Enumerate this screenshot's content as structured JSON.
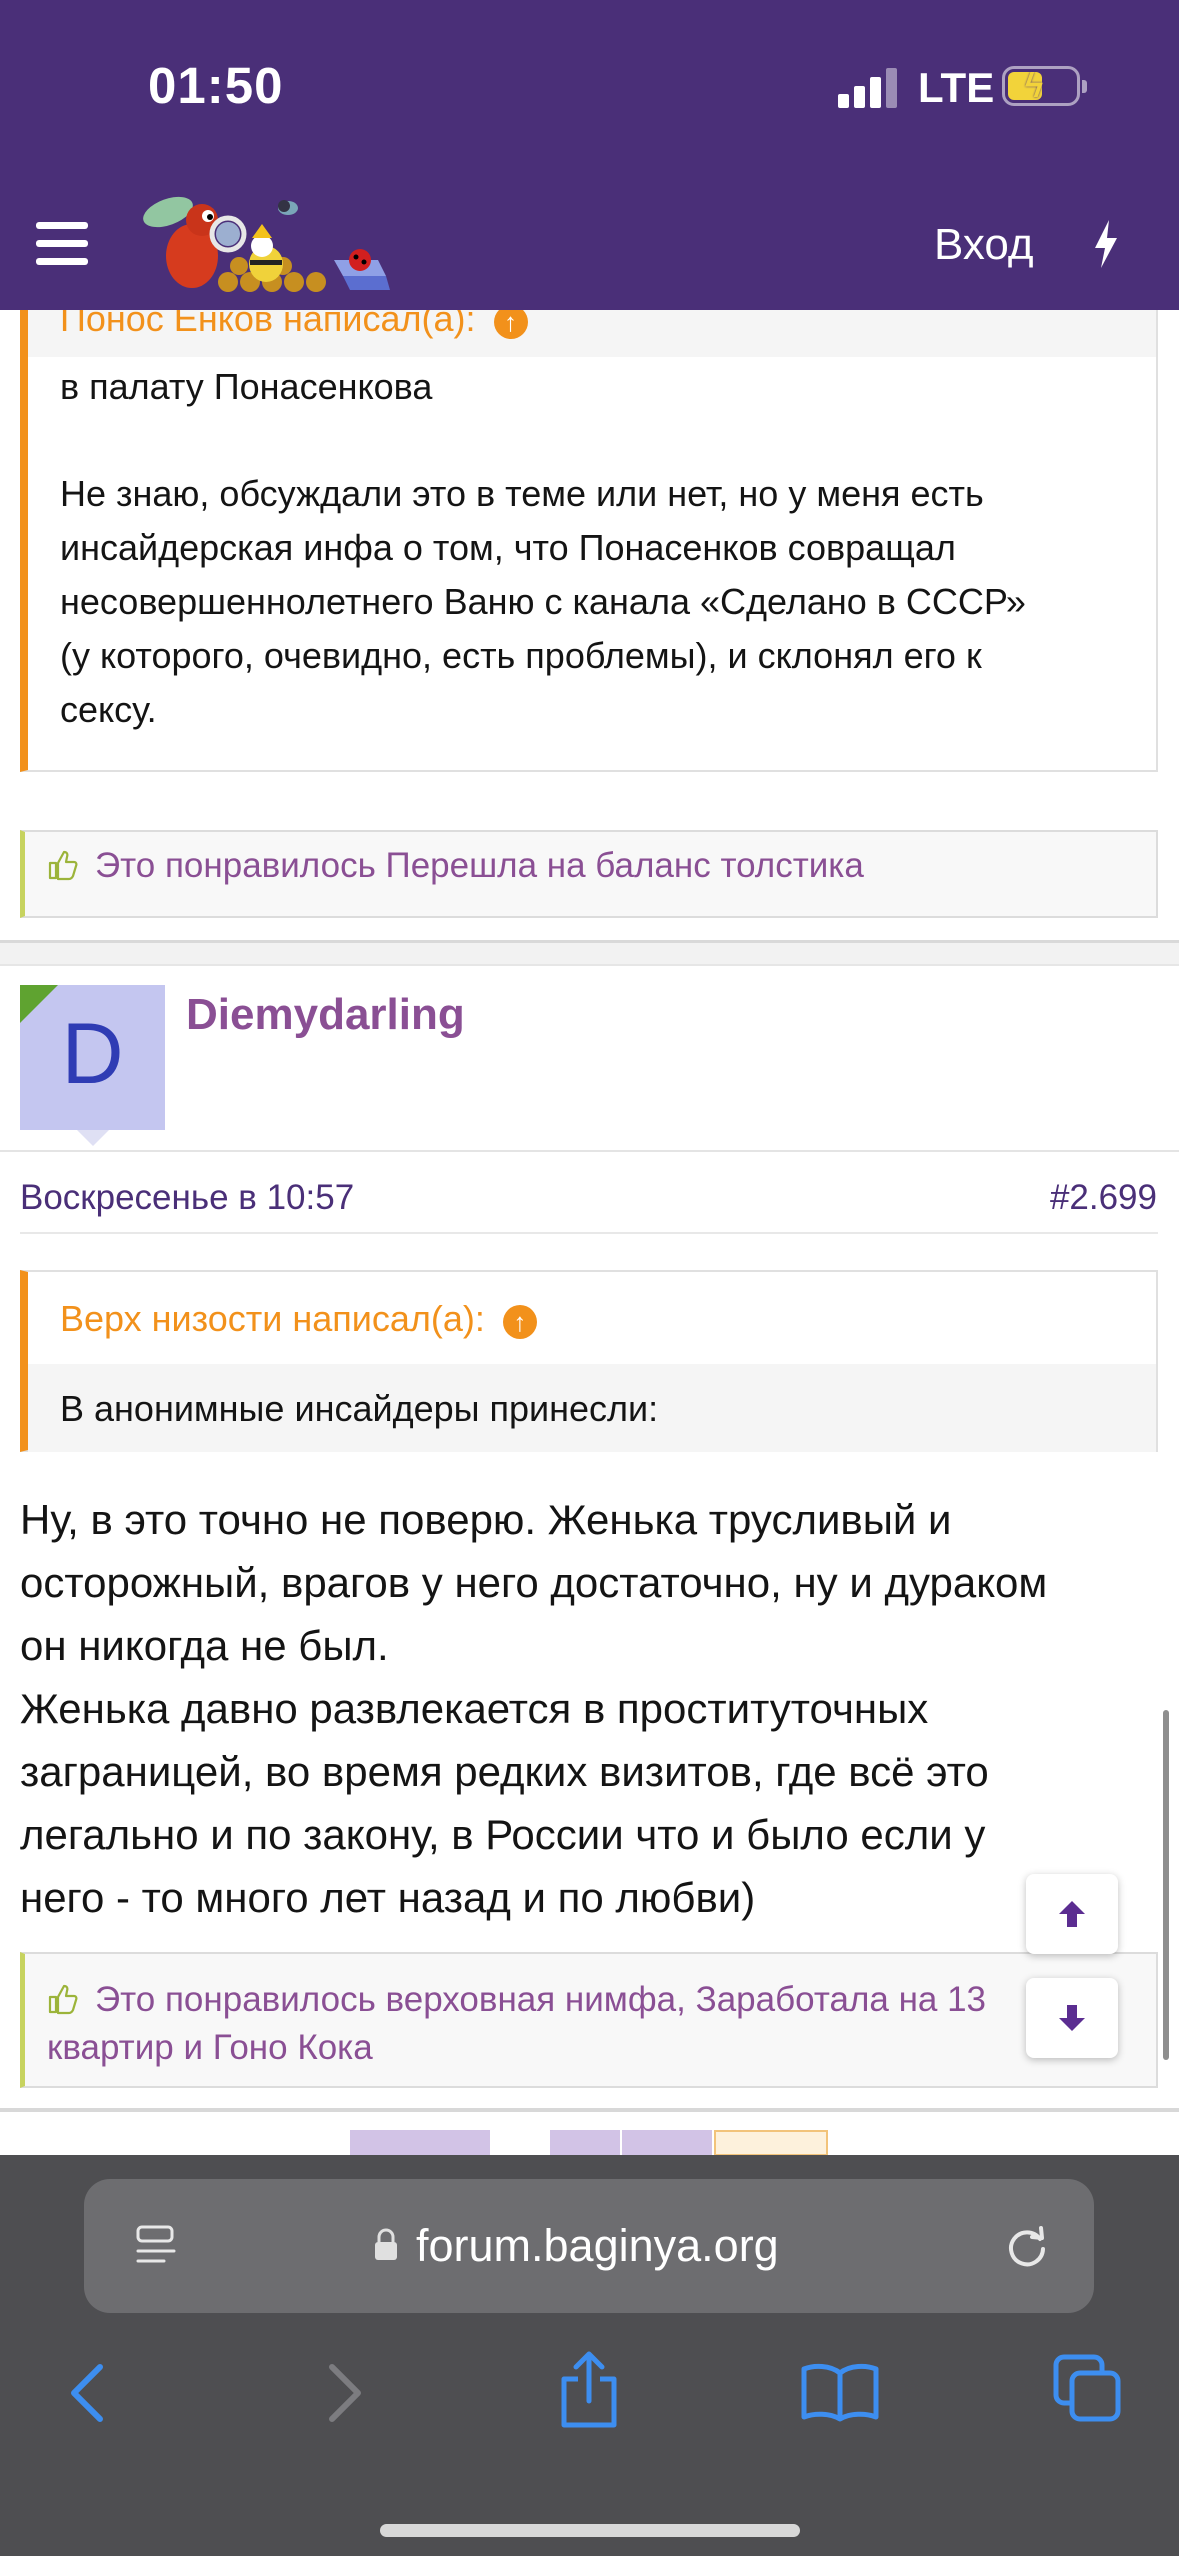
{
  "status_bar": {
    "time": "01:50",
    "network": "LTE"
  },
  "header": {
    "login_label": "Вход",
    "menu_icon": "hamburger-icon",
    "flash_icon": "lightning-icon",
    "logo_icon": "forum-logo-icon"
  },
  "post1": {
    "quote_author": "Понос Енков написал(а):",
    "quote_line1": "в палату Понасенкова",
    "quote_lines": [
      "Не знаю, обсуждали это в теме или нет, но у меня есть",
      "инсайдерская инфа о том, что Понасенков совращал",
      "несовершеннолетнего Ваню с канала «Сделано в СССР»",
      "(у которого, очевидно, есть проблемы), и склонял его к",
      "сексу."
    ],
    "likes": "Это понравилось Перешла на баланс толстика"
  },
  "post2": {
    "avatar_letter": "D",
    "username": "Diemydarling",
    "date": "Воскресенье в 10:57",
    "number": "#2.699",
    "quote_author": "Верх низости написал(а):",
    "quote_text": "В анонимные инсайдеры принесли:",
    "body_lines": [
      "Ну, в это точно не поверю. Женька трусливый и",
      "осторожный, врагов у него достаточно, ну и дураком",
      "он никогда не был.",
      "Женька давно развлекается в проституточных",
      "заграницей, во время редких визитов, где всё это",
      "легально и по закону, в России что и было если у",
      "него - то много лет назад и по любви)"
    ],
    "likes_line1": "Это понравилось верховная нимфа, Заработала на 13",
    "likes_line2": "квартир и Гоно Кока"
  },
  "browser": {
    "url": "forum.baginya.org"
  },
  "colors": {
    "header_bg": "#4a2f78",
    "quote_accent": "#f2911b",
    "link_purple": "#8a4f94",
    "like_border": "#c7d35f"
  }
}
